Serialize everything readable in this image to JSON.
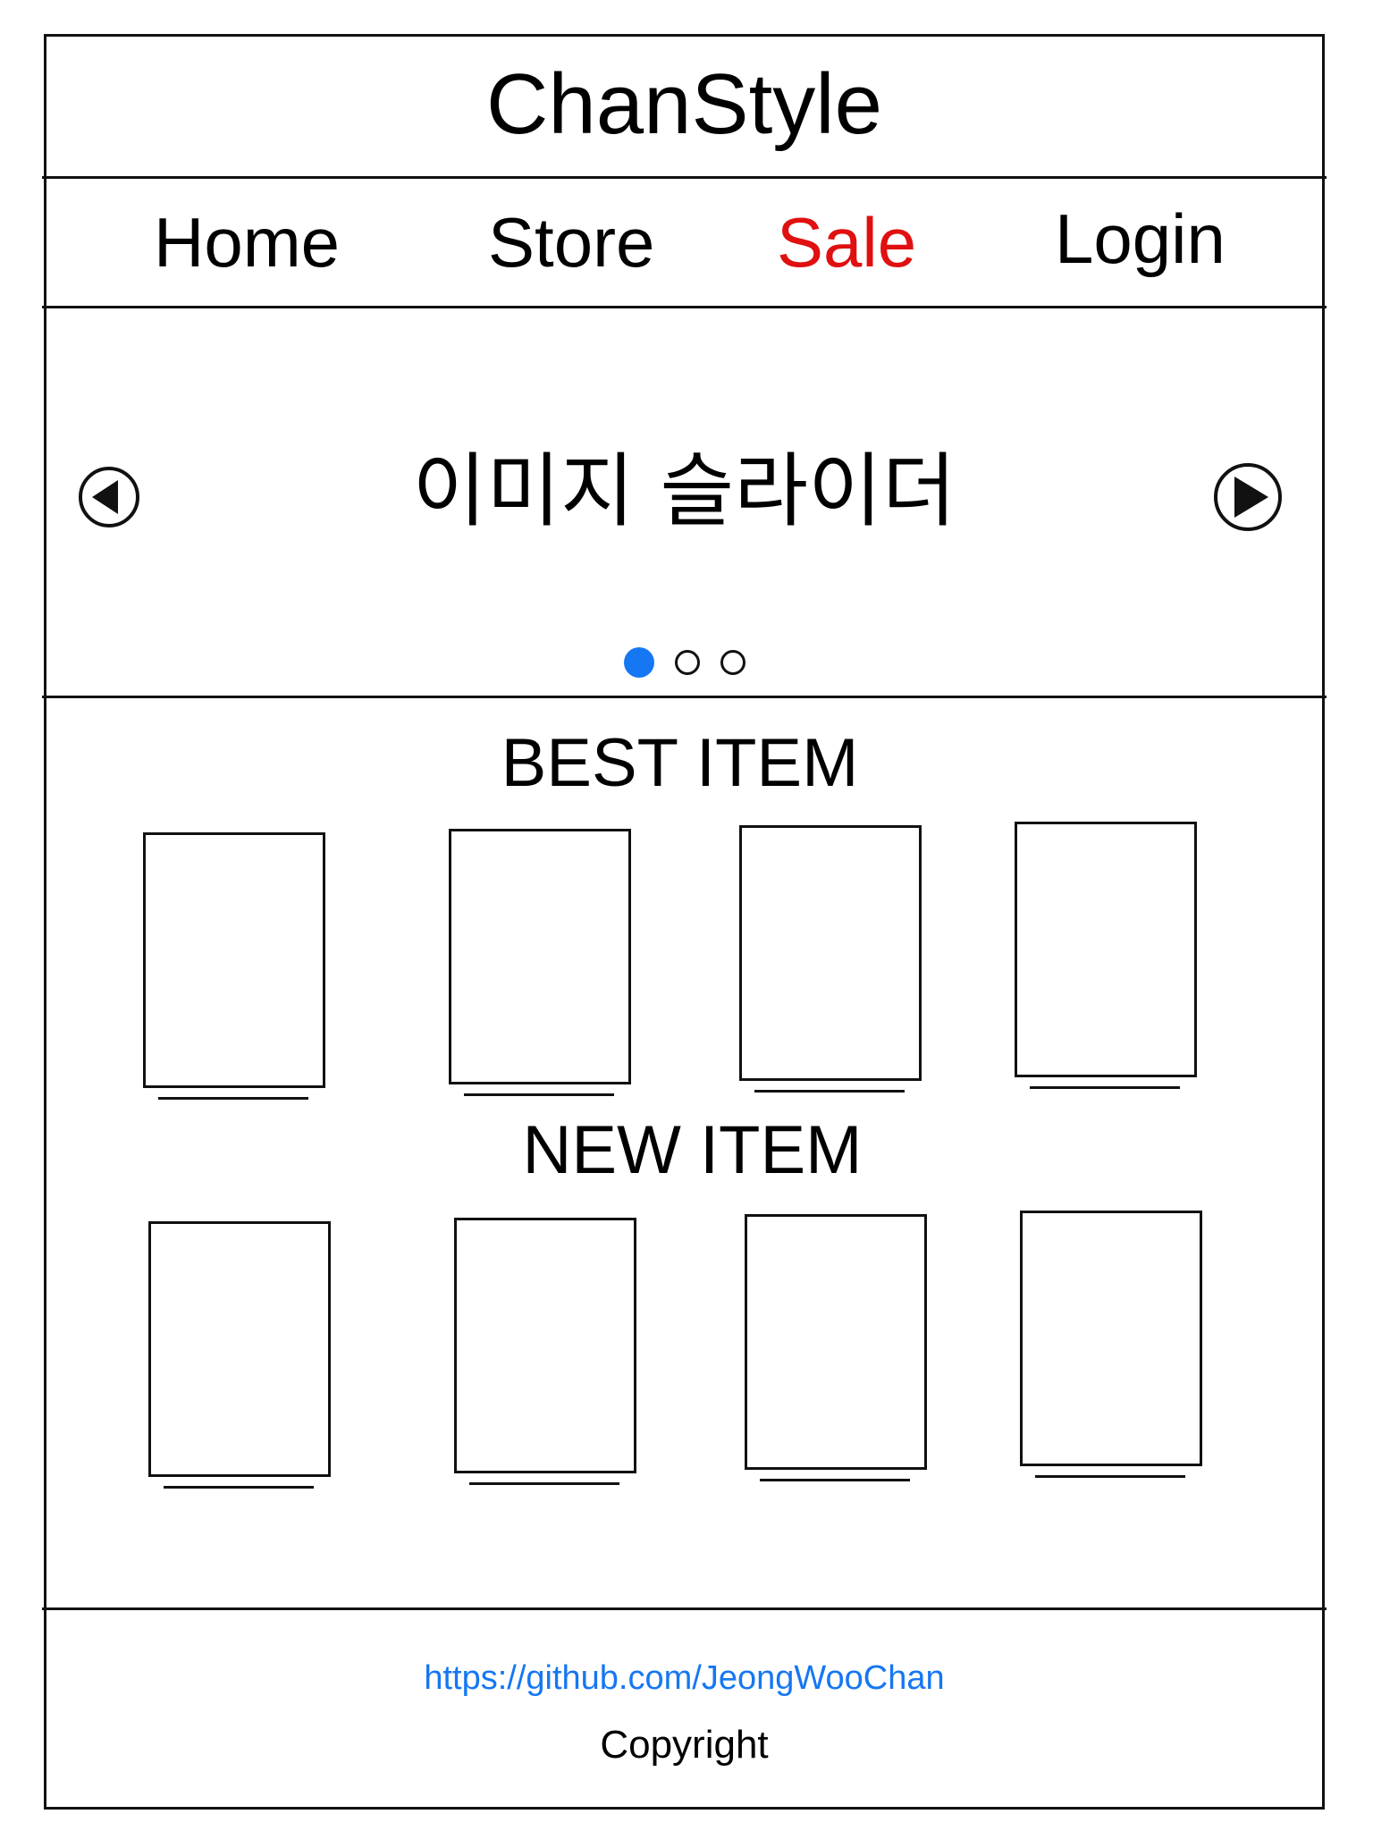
{
  "header": {
    "title": "ChanStyle"
  },
  "nav": {
    "items": [
      {
        "label": "Home"
      },
      {
        "label": "Store"
      },
      {
        "label": "Sale",
        "color": "#e01010"
      },
      {
        "label": "Login"
      }
    ]
  },
  "slider": {
    "label": "이미지 슬라이더",
    "prev_icon": "triangle-left-in-circle",
    "next_icon": "triangle-right-in-circle",
    "active_dot_color": "#1677f2",
    "dots": [
      {
        "active": true
      },
      {
        "active": false
      },
      {
        "active": false
      }
    ]
  },
  "sections": {
    "best": {
      "title": "BEST ITEM"
    },
    "new": {
      "title": "NEW ITEM"
    }
  },
  "footer": {
    "link": "https://github.com/JeongWooChan",
    "link_color": "#1677f2",
    "copyright": "Copyright"
  }
}
